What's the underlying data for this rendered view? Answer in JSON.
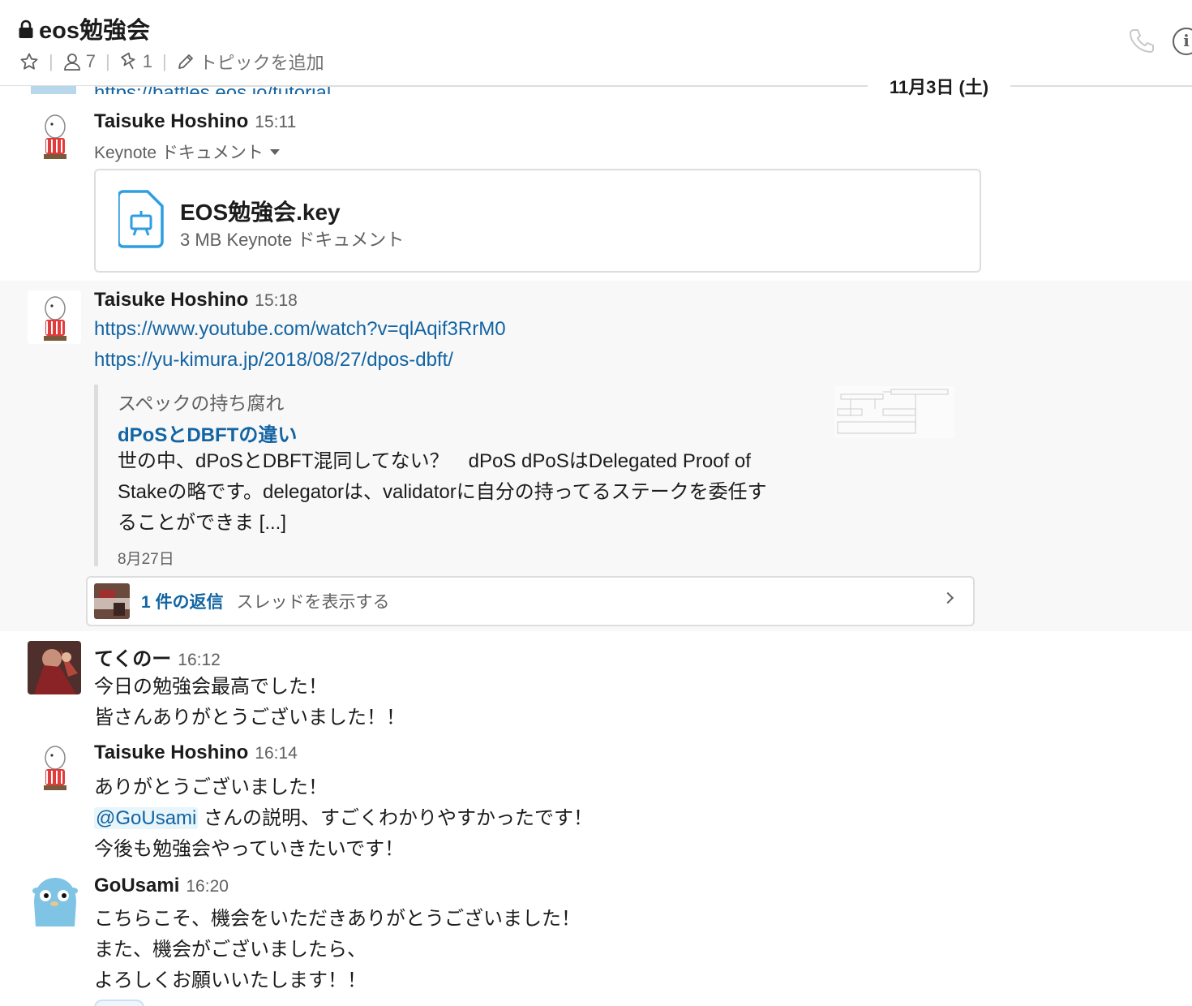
{
  "channel": {
    "name": "eos勉強会",
    "members": "7",
    "pins": "1",
    "topic_action": "トピックを追加"
  },
  "cutoff_link": "https://battles.eos.io/tutorial",
  "date_divider": "11月3日 (土)",
  "messages": [
    {
      "author": "Taisuke Hoshino",
      "time": "15:11",
      "file_type_label": "Keynote ドキュメント",
      "file": {
        "name": "EOS勉強会.key",
        "meta": "3 MB Keynote ドキュメント"
      }
    },
    {
      "author": "Taisuke Hoshino",
      "time": "15:18",
      "links": [
        "https://www.youtube.com/watch?v=qlAqif3RrM0",
        "https://yu-kimura.jp/2018/08/27/dpos-dbft/"
      ],
      "unfurl": {
        "site": "スペックの持ち腐れ",
        "title": "dPoSとDBFTの違い",
        "desc_1": "世の中、dPoSとDBFT混同してない？　dPoS dPoSはDelegated Proof of",
        "desc_2": "Stakeの略です。delegatorは、validatorに自分の持ってるステークを委任す",
        "desc_3": "ることができま [...]",
        "date": "8月27日"
      },
      "thread": {
        "count": "1 件の返信",
        "view": "スレッドを表示する"
      }
    },
    {
      "author": "てくのー",
      "time": "16:12",
      "lines": [
        "今日の勉強会最高でした！",
        "皆さんありがとうございました！！"
      ]
    },
    {
      "author": "Taisuke Hoshino",
      "time": "16:14",
      "line_1": "ありがとうございました！",
      "mention": "@GoUsami",
      "line_2_rest": " さんの説明、すごくわかりやすかったです！",
      "line_3": "今後も勉強会やっていきたいです！"
    },
    {
      "author": "GoUsami",
      "time": "16:20",
      "lines": [
        "こちらこそ、機会をいただきありがとうございました！",
        "また、機会がございましたら、",
        "よろしくお願いいたします！！"
      ]
    }
  ],
  "colors": {
    "link": "#1264a3",
    "hover_bg": "#f8f8f8",
    "file_icon": "#2d9ee0"
  },
  "icons": [
    "lock-icon",
    "star-icon",
    "person-icon",
    "pin-icon",
    "pencil-icon",
    "phone-icon",
    "info-icon",
    "keynote-file-icon",
    "chevron-right-icon",
    "dropdown-caret-icon"
  ]
}
